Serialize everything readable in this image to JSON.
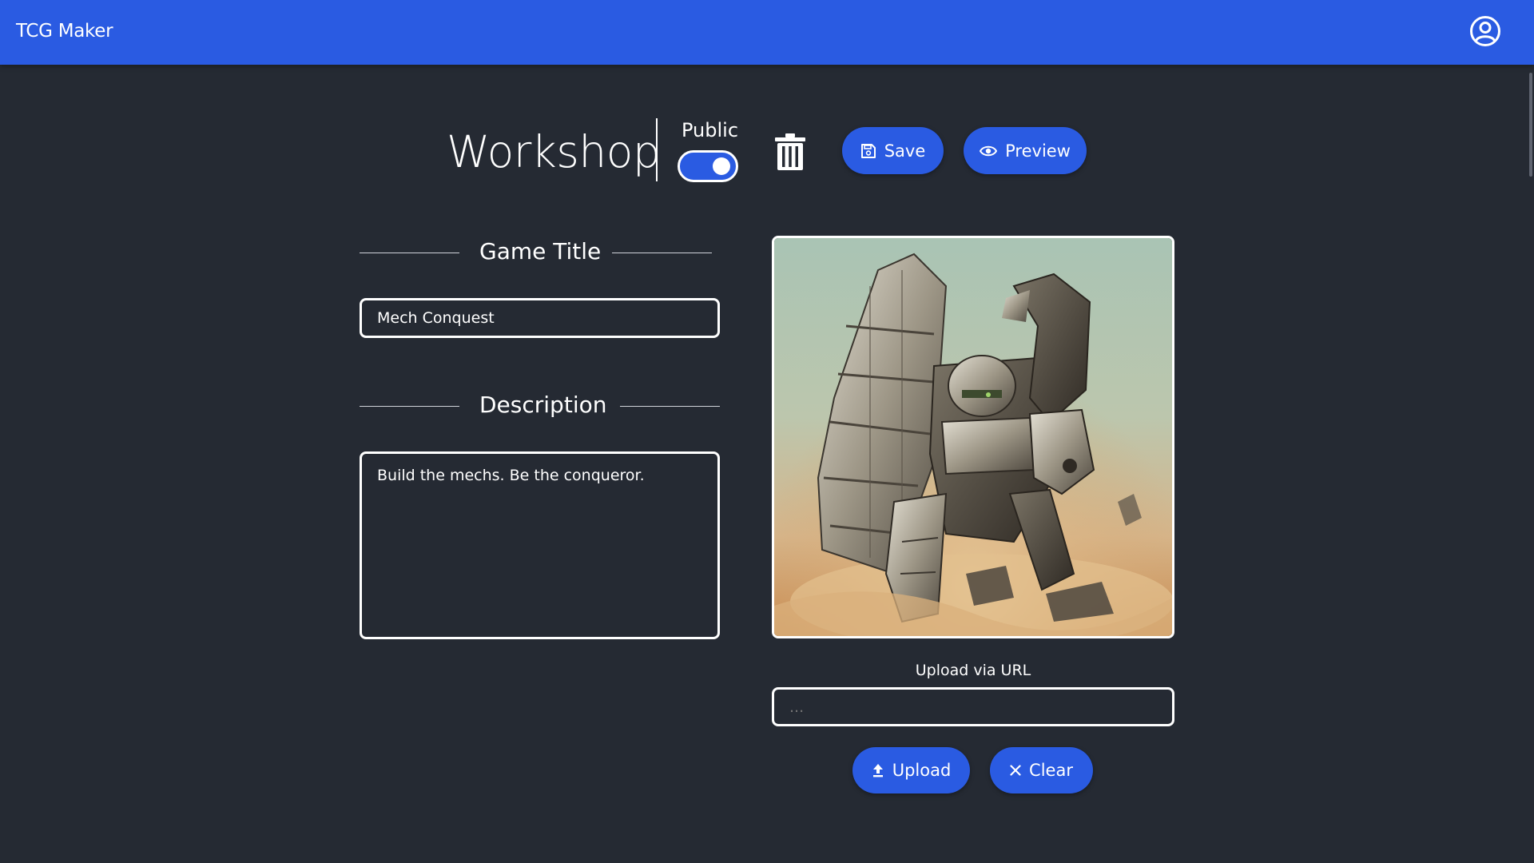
{
  "navbar": {
    "brand": "TCG Maker",
    "account_icon": "account-circle-icon",
    "color": "#2a5be2"
  },
  "workshop": {
    "title": "Workshop",
    "public_label": "Public",
    "public_enabled": true,
    "delete_icon": "trash-icon",
    "save_label": "Save",
    "preview_label": "Preview"
  },
  "game_title": {
    "header": "Game Title",
    "value": "Mech Conquest"
  },
  "description": {
    "header": "Description",
    "value": "Build the mechs. Be the conqueror."
  },
  "artwork": {
    "image_icon": "mech-artwork-image",
    "upload_label": "Upload via URL",
    "url_placeholder": "...",
    "upload_button": "Upload",
    "clear_button": "Clear"
  },
  "colors": {
    "background": "#252a33",
    "accent": "#2a5be2",
    "text": "#ffffff"
  }
}
